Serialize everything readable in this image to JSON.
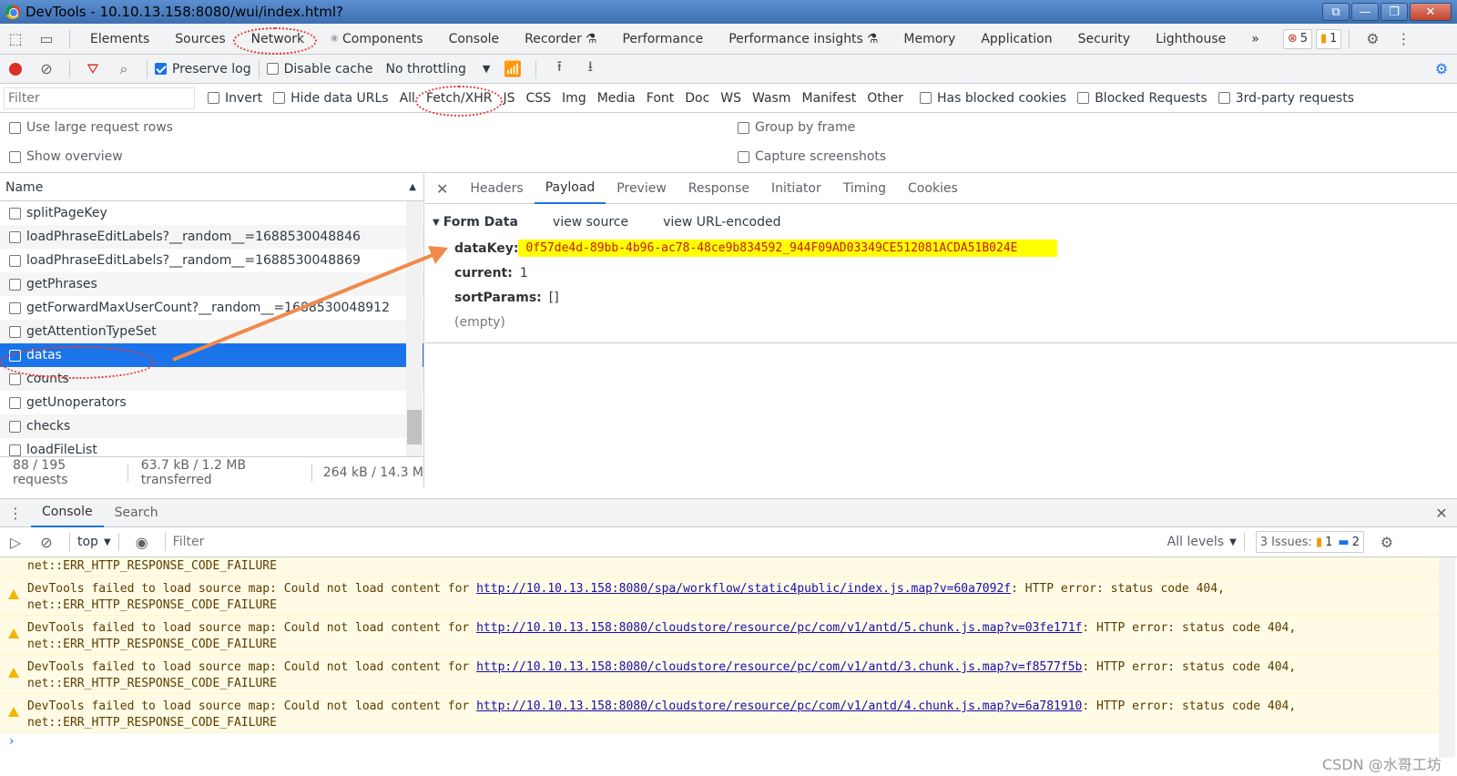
{
  "window": {
    "title": "DevTools - 10.10.13.158:8080/wui/index.html?"
  },
  "main_tabs": [
    "Elements",
    "Sources",
    "Network",
    "Components",
    "Console",
    "Recorder",
    "Performance",
    "Performance insights",
    "Memory",
    "Application",
    "Security",
    "Lighthouse"
  ],
  "tab_more": "»",
  "badges": {
    "errors": "5",
    "warnings": "1"
  },
  "network_toolbar": {
    "preserve_log": "Preserve log",
    "disable_cache": "Disable cache",
    "throttling": "No throttling"
  },
  "filter_bar": {
    "placeholder": "Filter",
    "invert": "Invert",
    "hide_data_urls": "Hide data URLs",
    "types": [
      "All",
      "Fetch/XHR",
      "JS",
      "CSS",
      "Img",
      "Media",
      "Font",
      "Doc",
      "WS",
      "Wasm",
      "Manifest",
      "Other"
    ],
    "has_blocked_cookies": "Has blocked cookies",
    "blocked_requests": "Blocked Requests",
    "third_party": "3rd-party requests"
  },
  "options": {
    "large_rows": "Use large request rows",
    "show_overview": "Show overview",
    "group_by_frame": "Group by frame",
    "capture_screenshots": "Capture screenshots"
  },
  "requests": {
    "header": "Name",
    "items": [
      "splitPageKey",
      "loadPhraseEditLabels?__random__=1688530048846",
      "loadPhraseEditLabels?__random__=1688530048869",
      "getPhrases",
      "getForwardMaxUserCount?__random__=1688530048912",
      "getAttentionTypeSet",
      "datas",
      "counts",
      "getUnoperators",
      "checks",
      "loadFileList"
    ]
  },
  "status": {
    "requests": "88 / 195 requests",
    "transferred": "63.7 kB / 1.2 MB transferred",
    "resources": "264 kB / 14.3 M"
  },
  "detail_tabs": [
    "Headers",
    "Payload",
    "Preview",
    "Response",
    "Initiator",
    "Timing",
    "Cookies"
  ],
  "payload": {
    "section": "Form Data",
    "view_source": "view source",
    "view_url_encoded": "view URL-encoded",
    "datakey_label": "dataKey:",
    "datakey_value": "0f57de4d-89bb-4b96-ac78-48ce9b834592_944F09AD03349CE512081ACDA51B024E",
    "current_label": "current:",
    "current_value": "1",
    "sortparams_label": "sortParams:",
    "sortparams_value": "[]",
    "empty": "(empty)"
  },
  "drawer": {
    "console_tab": "Console",
    "search_tab": "Search"
  },
  "console_toolbar": {
    "context": "top",
    "filter_placeholder": "Filter",
    "levels": "All levels",
    "issues_label": "3 Issues:",
    "issues_warn": "1",
    "issues_info": "2"
  },
  "console": {
    "first_line": "net::ERR_HTTP_RESPONSE_CODE_FAILURE",
    "messages": [
      {
        "prefix": "DevTools failed to load source map: Could not load content for ",
        "url": "http://10.10.13.158:8080/spa/workflow/static4public/index.js.map?v=60a7092f",
        "suffix": ": HTTP error: status code 404,",
        "line2": "net::ERR_HTTP_RESPONSE_CODE_FAILURE"
      },
      {
        "prefix": "DevTools failed to load source map: Could not load content for ",
        "url": "http://10.10.13.158:8080/cloudstore/resource/pc/com/v1/antd/5.chunk.js.map?v=03fe171f",
        "suffix": ": HTTP error: status code 404,",
        "line2": "net::ERR_HTTP_RESPONSE_CODE_FAILURE"
      },
      {
        "prefix": "DevTools failed to load source map: Could not load content for ",
        "url": "http://10.10.13.158:8080/cloudstore/resource/pc/com/v1/antd/3.chunk.js.map?v=f8577f5b",
        "suffix": ": HTTP error: status code 404,",
        "line2": "net::ERR_HTTP_RESPONSE_CODE_FAILURE"
      },
      {
        "prefix": "DevTools failed to load source map: Could not load content for ",
        "url": "http://10.10.13.158:8080/cloudstore/resource/pc/com/v1/antd/4.chunk.js.map?v=6a781910",
        "suffix": ": HTTP error: status code 404,",
        "line2": "net::ERR_HTTP_RESPONSE_CODE_FAILURE"
      }
    ]
  },
  "watermark": "CSDN @水哥工坊",
  "colors": {
    "selected_row": "#1a73e8",
    "highlight": "#ffff00",
    "annotation": "#e53935",
    "arrow": "#f08a4b"
  }
}
